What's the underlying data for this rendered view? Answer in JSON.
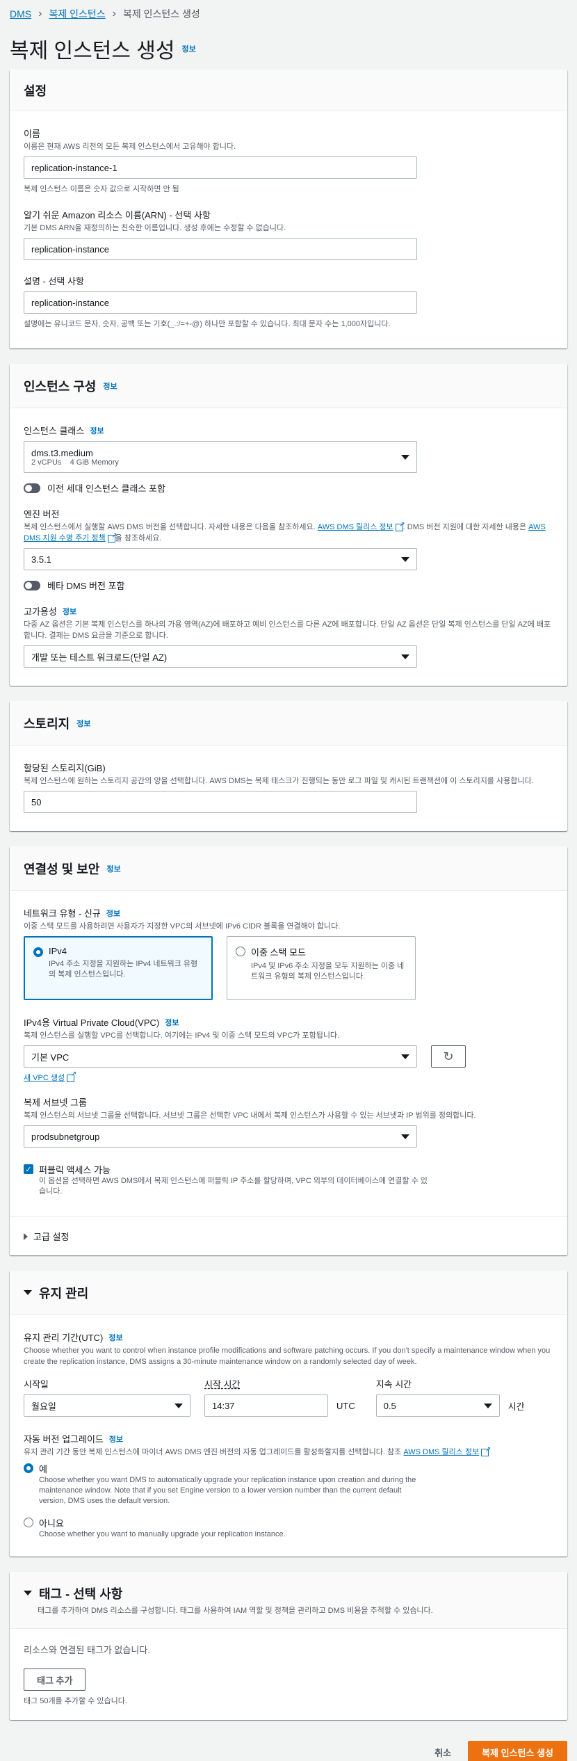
{
  "breadcrumb": [
    "DMS",
    "복제 인스턴스",
    "복제 인스턴스 생성"
  ],
  "page": {
    "title": "복제 인스턴스 생성",
    "info": "정보"
  },
  "settings": {
    "title": "설정",
    "name_label": "이름",
    "name_desc": "이름은 현재 AWS 리전의 모든 복제 인스턴스에서 고유해야 합니다.",
    "name_value": "replication-instance-1",
    "name_hint": "복제 인스턴스 이름은 숫자 값으로 시작하면 안 됨",
    "arn_label": "알기 쉬운 Amazon 리소스 이름(ARN) - 선택 사항",
    "arn_desc": "기본 DMS ARN을 재정의하는 친숙한 이름입니다. 생성 후에는 수정할 수 없습니다.",
    "arn_value": "replication-instance",
    "desc_label": "설명 - 선택 사항",
    "desc_value": "replication-instance",
    "desc_hint": "설명에는 유니코드 문자, 숫자, 공백 또는 기호(_.:/=+-@) 하나만 포함할 수 있습니다. 최대 문자 수는 1,000자입니다."
  },
  "instance": {
    "title": "인스턴스 구성",
    "info": "정보",
    "class_label": "인스턴스 클래스",
    "class_value": "dms.t3.medium",
    "class_sub": "2 vCPUs    4 GiB Memory",
    "prev_gen": "이전 세대 인스턴스 클래스 포함",
    "engine_label": "엔진 버전",
    "engine_desc_1": "복제 인스턴스에서 실행할 AWS DMS 버전을 선택합니다. 자세한 내용은 다음을 참조하세요.",
    "engine_link_1": "AWS DMS 릴리스 정보",
    "engine_desc_2": ". DMS 버전 지원에 대한 자세한 내용은",
    "engine_link_2": "AWS DMS 지원 수명 주기 정책",
    "engine_desc_3": "을 참조하세요.",
    "engine_value": "3.5.1",
    "beta": "베타 DMS 버전 포함",
    "ha_label": "고가용성",
    "ha_desc": "다중 AZ 옵션은 기본 복제 인스턴스를 하나의 가용 영역(AZ)에 배포하고 예비 인스턴스를 다른 AZ에 배포합니다. 단일 AZ 옵션은 단일 복제 인스턴스를 단일 AZ에 배포합니다. 결제는 DMS 요금을 기준으로 합니다.",
    "ha_value": "개발 또는 테스트 워크로드(단일 AZ)"
  },
  "storage": {
    "title": "스토리지",
    "info": "정보",
    "label": "할당된 스토리지(GiB)",
    "desc": "복제 인스턴스에 원하는 스토리지 공간의 양을 선택합니다. AWS DMS는 복제 태스크가 진행되는 동안 로그 파일 및 캐시된 트랜잭션에 이 스토리지를 사용합니다.",
    "value": "50"
  },
  "network": {
    "title": "연결성 및 보안",
    "info": "정보",
    "type_label": "네트워크 유형 - 신규",
    "type_desc": "이중 스택 모드를 사용하려면 사용자가 지정한 VPC의 서브넷에 IPv6 CIDR 블록을 연결해야 합니다.",
    "ipv4_title": "IPv4",
    "ipv4_desc": "IPv4 주소 지정을 지원하는 IPv4 네트워크 유형의 복제 인스턴스입니다.",
    "dual_title": "이중 스택 모드",
    "dual_desc": "IPv4 및 IPv6 주소 지정을 모두 지원하는 이중 네트워크 유형의 복제 인스턴스입니다.",
    "vpc_label": "IPv4용 Virtual Private Cloud(VPC)",
    "vpc_desc": "복제 인스턴스를 실행할 VPC를 선택합니다. 여기에는 IPv4 및 이중 스택 모드의 VPC가 포함됩니다.",
    "vpc_value": "기본 VPC",
    "new_vpc": "새 VPC 생성",
    "subnet_label": "복제 서브넷 그룹",
    "subnet_desc": "복제 인스턴스의 서브넷 그룹을 선택합니다. 서브넷 그룹은 선택한 VPC 내에서 복제 인스턴스가 사용할 수 있는 서브넷과 IP 범위를 정의합니다.",
    "subnet_value": "prodsubnetgroup",
    "public_label": "퍼블릭 액세스 가능",
    "public_desc": "이 옵션을 선택하면 AWS DMS에서 복제 인스턴스에 퍼블릭 IP 주소를 할당하며, VPC 외부의 데이터베이스에 연결할 수 있습니다.",
    "advanced": "고급 설정"
  },
  "maintenance": {
    "title": "유지 관리",
    "window_label": "유지 관리 기간(UTC)",
    "info": "정보",
    "window_desc": "Choose whether you want to control when instance profile modifications and software patching occurs. If you don't specify a maintenance window when you create the replication instance, DMS assigns a 30-minute maintenance window on a randomly selected day of week.",
    "start_day_label": "시작일",
    "start_day": "월요일",
    "start_time_label": "시작 시간",
    "start_time": "14:37",
    "utc": "UTC",
    "duration_label": "지속 시간",
    "duration": "0.5",
    "hours": "시간",
    "auto_label": "자동 버전 업그레이드",
    "auto_desc_1": "유지 관리 기간 동안 복제 인스턴스에 마이너 AWS DMS 엔진 버전의 자동 업그레이드를 활성화할지를 선택합니다. 참조",
    "auto_link": "AWS DMS 릴리스 정보",
    "yes_title": "예",
    "yes_desc": "Choose whether you want DMS to automatically upgrade your replication instance upon creation and during the maintenance window. Note that if you set Engine version to a lower version number than the current default version, DMS uses the default version.",
    "no_title": "아니요",
    "no_desc": "Choose whether you want to manually upgrade your replication instance."
  },
  "tags": {
    "title": "태그 - 선택 사항",
    "desc": "태그를 추가하여 DMS 리소스를 구성합니다. 태그를 사용하여 IAM 역할 및 정책을 관리하고 DMS 비용을 추적할 수 있습니다.",
    "empty": "리소스와 연결된 태그가 없습니다.",
    "add": "태그 추가",
    "limit": "태그 50개를 추가할 수 있습니다."
  },
  "footer": {
    "cancel": "취소",
    "create": "복제 인스턴스 생성"
  }
}
